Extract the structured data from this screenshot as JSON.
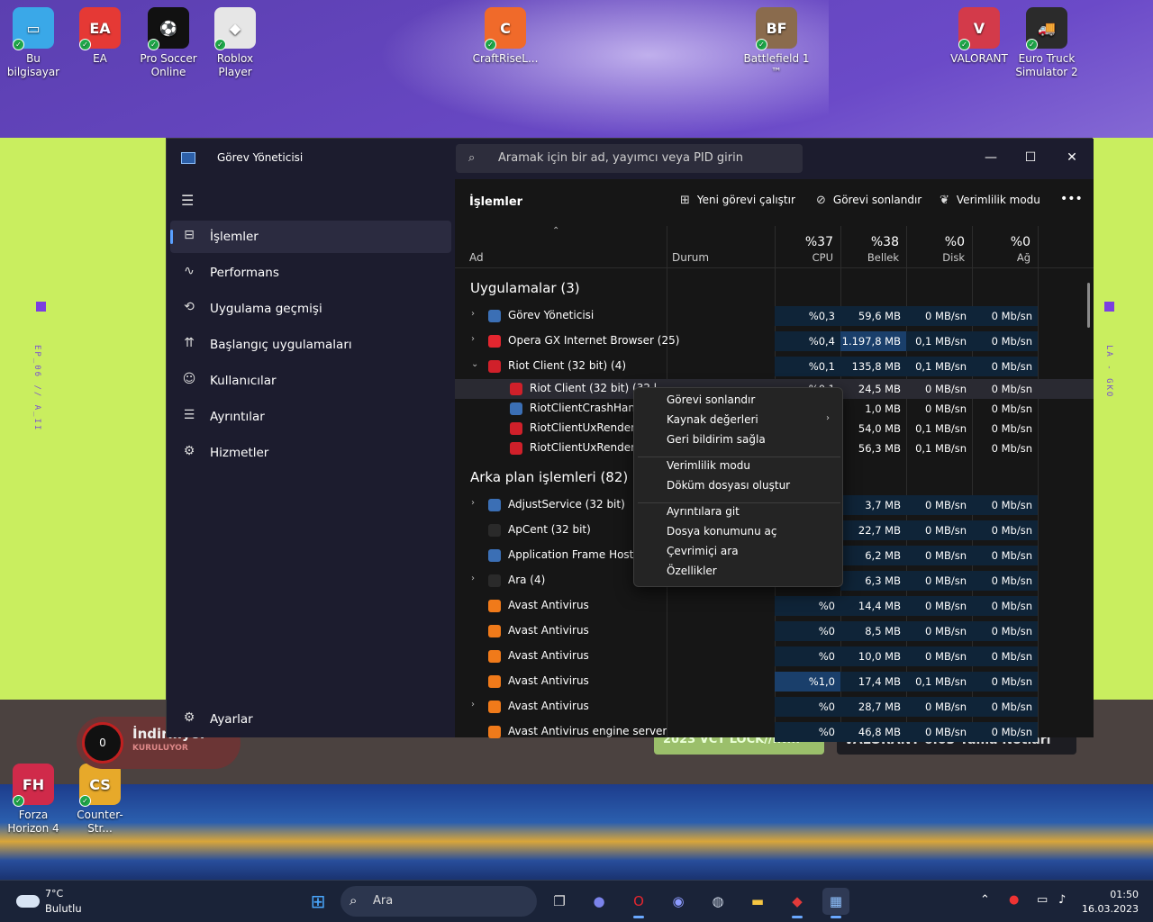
{
  "desktop_icons": [
    {
      "label": "Bu bilgisayar",
      "color": "#3aa8e8",
      "glyph": "▭"
    },
    {
      "label": "EA",
      "color": "#e53935",
      "glyph": "EA"
    },
    {
      "label": "Pro Soccer Online",
      "color": "#111111",
      "glyph": "⚽"
    },
    {
      "label": "Roblox Player",
      "color": "#e6e6e6",
      "glyph": "◆"
    },
    {
      "label": "CraftRiseL...",
      "color": "#f06a2a",
      "glyph": "C"
    },
    {
      "label": "Battlefield 1 ™",
      "color": "#8a6b4d",
      "glyph": "BF"
    },
    {
      "label": "VALORANT",
      "color": "#d33a4a",
      "glyph": "V"
    },
    {
      "label": "Euro Truck Simulator 2",
      "color": "#2b2b2b",
      "glyph": "🚚"
    },
    {
      "label": "Forza Horizon 4",
      "color": "#d02a4a",
      "glyph": "FH"
    },
    {
      "label": "Counter-Str...",
      "color": "#e7a92a",
      "glyph": "CS"
    }
  ],
  "task_manager": {
    "app_title": "Görev Yöneticisi",
    "search_placeholder": "Aramak için bir ad, yayımcı veya PID girin",
    "window_buttons": {
      "minimize": "—",
      "maximize": "☐",
      "close": "✕"
    },
    "nav": [
      {
        "label": "İşlemler",
        "icon": "processes-icon",
        "active": true
      },
      {
        "label": "Performans",
        "icon": "performance-icon"
      },
      {
        "label": "Uygulama geçmişi",
        "icon": "history-icon"
      },
      {
        "label": "Başlangıç uygulamaları",
        "icon": "startup-icon"
      },
      {
        "label": "Kullanıcılar",
        "icon": "users-icon"
      },
      {
        "label": "Ayrıntılar",
        "icon": "details-icon"
      },
      {
        "label": "Hizmetler",
        "icon": "services-icon"
      }
    ],
    "settings_label": "Ayarlar",
    "section_title": "İşlemler",
    "toolbar": {
      "run_new_task": "Yeni görevi çalıştır",
      "end_task": "Görevi sonlandır",
      "efficiency_mode": "Verimlilik modu",
      "more": "•••"
    },
    "columns": {
      "name": "Ad",
      "status": "Durum",
      "cpu": {
        "percent": "%37",
        "label": "CPU"
      },
      "memory": {
        "percent": "%38",
        "label": "Bellek"
      },
      "disk": {
        "percent": "%0",
        "label": "Disk"
      },
      "network": {
        "percent": "%0",
        "label": "Ağ"
      }
    },
    "groups": {
      "apps": "Uygulamalar (3)",
      "background": "Arka plan işlemleri (82)"
    },
    "app_rows": [
      {
        "name": "Görev Yöneticisi",
        "expand": "›",
        "icon_color": "#3b6fb5",
        "cpu": "%0,3",
        "memory": "59,6 MB",
        "disk": "0 MB/sn",
        "network": "0 Mb/sn",
        "cpu_level": 1,
        "mem_level": 1
      },
      {
        "name": "Opera GX Internet Browser (25)",
        "expand": "›",
        "icon_color": "#e3262f",
        "cpu": "%0,4",
        "memory": "1.197,8 MB",
        "disk": "0,1 MB/sn",
        "network": "0 Mb/sn",
        "cpu_level": 1,
        "mem_level": 2
      },
      {
        "name": "Riot Client (32 bit) (4)",
        "expand": "⌄",
        "icon_color": "#d0202a",
        "cpu": "%0,1",
        "memory": "135,8 MB",
        "disk": "0,1 MB/sn",
        "network": "0 Mb/sn",
        "cpu_level": 1,
        "mem_level": 1
      }
    ],
    "child_rows": [
      {
        "name": "Riot Client (32 bit) (32 bit)",
        "icon_color": "#d0202a",
        "cpu": "%0,1",
        "memory": "24,5 MB",
        "disk": "0 MB/sn",
        "network": "0 Mb/sn",
        "selected": true
      },
      {
        "name": "RiotClientCrashHandler",
        "icon_color": "#3b6fb5",
        "cpu": "%0",
        "memory": "1,0 MB",
        "disk": "0 MB/sn",
        "network": "0 Mb/sn"
      },
      {
        "name": "RiotClientUxRender (32 bit)",
        "icon_color": "#d0202a",
        "cpu": "%0",
        "memory": "54,0 MB",
        "disk": "0,1 MB/sn",
        "network": "0 Mb/sn"
      },
      {
        "name": "RiotClientUxRender (32 bit)",
        "icon_color": "#d0202a",
        "cpu": "%0",
        "memory": "56,3 MB",
        "disk": "0,1 MB/sn",
        "network": "0 Mb/sn"
      }
    ],
    "background_rows": [
      {
        "name": "AdjustService (32 bit)",
        "expand": "›",
        "icon_color": "#3b6fb5",
        "cpu": "",
        "memory": "3,7 MB",
        "disk": "0 MB/sn",
        "network": "0 Mb/sn",
        "cpu_level": 0,
        "mem_level": 1
      },
      {
        "name": "ApCent (32 bit)",
        "expand": "",
        "icon_color": "#2a2a2a",
        "cpu": "",
        "memory": "22,7 MB",
        "disk": "0 MB/sn",
        "network": "0 Mb/sn",
        "cpu_level": 0,
        "mem_level": 1
      },
      {
        "name": "Application Frame Host",
        "expand": "",
        "icon_color": "#3b6fb5",
        "cpu": "",
        "memory": "6,2 MB",
        "disk": "0 MB/sn",
        "network": "0 Mb/sn",
        "cpu_level": 0,
        "mem_level": 1
      },
      {
        "name": "Ara (4)",
        "expand": "›",
        "icon_color": "#2a2a2a",
        "cpu": "",
        "memory": "6,3 MB",
        "disk": "0 MB/sn",
        "network": "0 Mb/sn",
        "cpu_level": 0,
        "mem_level": 1
      },
      {
        "name": "Avast Antivirus",
        "expand": "",
        "icon_color": "#f07a1a",
        "cpu": "%0",
        "memory": "14,4 MB",
        "disk": "0 MB/sn",
        "network": "0 Mb/sn",
        "cpu_level": 1,
        "mem_level": 1
      },
      {
        "name": "Avast Antivirus",
        "expand": "",
        "icon_color": "#f07a1a",
        "cpu": "%0",
        "memory": "8,5 MB",
        "disk": "0 MB/sn",
        "network": "0 Mb/sn",
        "cpu_level": 1,
        "mem_level": 1
      },
      {
        "name": "Avast Antivirus",
        "expand": "",
        "icon_color": "#f07a1a",
        "cpu": "%0",
        "memory": "10,0 MB",
        "disk": "0 MB/sn",
        "network": "0 Mb/sn",
        "cpu_level": 1,
        "mem_level": 1
      },
      {
        "name": "Avast Antivirus",
        "expand": "",
        "icon_color": "#f07a1a",
        "cpu": "%1,0",
        "memory": "17,4 MB",
        "disk": "0,1 MB/sn",
        "network": "0 Mb/sn",
        "cpu_level": 2,
        "mem_level": 1
      },
      {
        "name": "Avast Antivirus",
        "expand": "›",
        "icon_color": "#f07a1a",
        "cpu": "%0",
        "memory": "28,7 MB",
        "disk": "0 MB/sn",
        "network": "0 Mb/sn",
        "cpu_level": 1,
        "mem_level": 1
      },
      {
        "name": "Avast Antivirus engine server",
        "expand": "",
        "icon_color": "#f07a1a",
        "cpu": "%0",
        "memory": "46,8 MB",
        "disk": "0 MB/sn",
        "network": "0 Mb/sn",
        "cpu_level": 1,
        "mem_level": 1
      }
    ],
    "context_menu": [
      {
        "label": "Görevi sonlandır"
      },
      {
        "label": "Kaynak değerleri",
        "submenu": "›"
      },
      {
        "label": "Geri bildirim sağla"
      },
      {
        "separator": true
      },
      {
        "label": "Verimlilik modu"
      },
      {
        "label": "Döküm dosyası oluştur"
      },
      {
        "separator": true
      },
      {
        "label": "Ayrıntılara git"
      },
      {
        "label": "Dosya konumunu aç"
      },
      {
        "label": "Çevrimiçi ara"
      },
      {
        "label": "Özellikler"
      }
    ]
  },
  "download_widget": {
    "title": "İndiriliyor",
    "subtitle": "KURULUYOR",
    "count": "0"
  },
  "news": [
    "2023 VCT LOCK//IN...",
    "VALORANT 6.03 Yama Notları"
  ],
  "taskbar": {
    "weather_temp": "7°C",
    "weather_cond": "Bulutlu",
    "search_label": "Ara",
    "icons": [
      "windows-start-icon",
      "task-view-icon",
      "teams-chat-icon",
      "opera-gx-icon",
      "discord-icon",
      "steam-icon",
      "file-explorer-icon",
      "riot-client-icon",
      "task-manager-icon"
    ],
    "time": "01:50",
    "date": "16.03.2023"
  }
}
